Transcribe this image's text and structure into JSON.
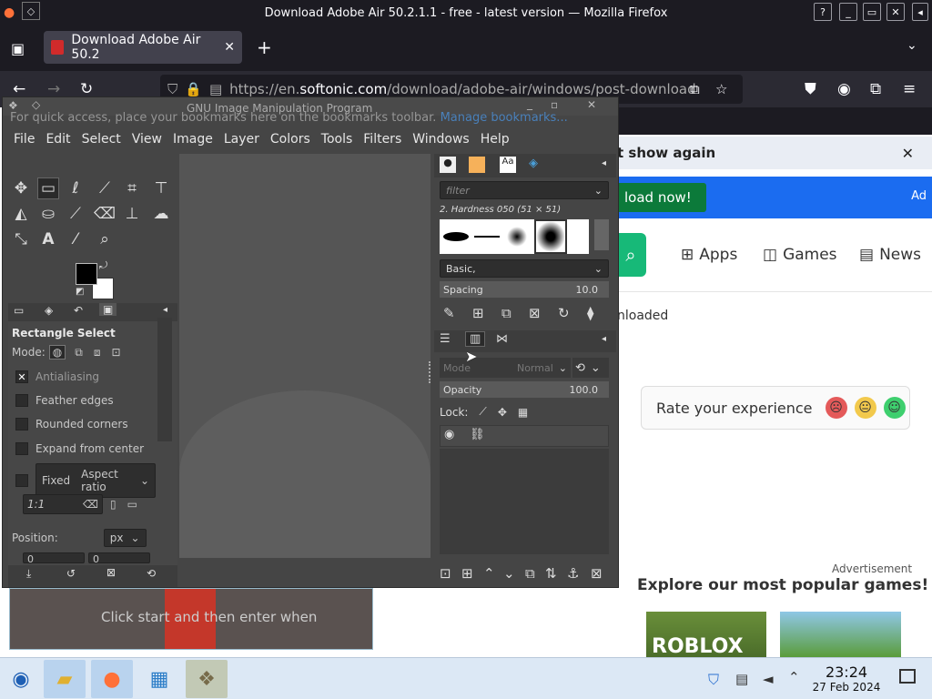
{
  "firefox": {
    "window_title": "Download Adobe Air 50.2.1.1 - free - latest version — Mozilla Firefox",
    "tab_title": "Download Adobe Air 50.2",
    "url_prefix": "https://en.",
    "url_domain": "softonic.com",
    "url_rest": "/download/adobe-air/windows/post-download",
    "bookmarks_hint": "For quick access, place your bookmarks here on the bookmarks toolbar.",
    "manage_bookmarks": "Manage bookmarks..."
  },
  "web": {
    "notice": "t show again",
    "download_now": "load now!",
    "ad_label": "Ad",
    "nav": [
      {
        "label": "Apps"
      },
      {
        "label": "Games"
      },
      {
        "label": "News"
      }
    ],
    "downloaded": "nloaded",
    "rate": "Rate your experience",
    "advertisement": "Advertisement",
    "explore": "Explore our most popular games!",
    "game1": "ROBLOX",
    "below_text": "Click start and then enter when"
  },
  "gimp": {
    "title": "GNU Image Manipulation Program",
    "menu": [
      {
        "label": "File"
      },
      {
        "label": "Edit"
      },
      {
        "label": "Select"
      },
      {
        "label": "View"
      },
      {
        "label": "Image"
      },
      {
        "label": "Layer"
      },
      {
        "label": "Colors"
      },
      {
        "label": "Tools"
      },
      {
        "label": "Filters"
      },
      {
        "label": "Windows"
      },
      {
        "label": "Help"
      }
    ],
    "tool_options_title": "Rectangle Select",
    "mode_label": "Mode:",
    "antialiasing": "Antialiasing",
    "feather": "Feather edges",
    "rounded": "Rounded corners",
    "expand": "Expand from center",
    "fixed": "Fixed",
    "aspect": "Aspect ratio",
    "ratio": "1:1",
    "position": "Position:",
    "unit": "px",
    "pos_x": "0",
    "pos_y": "0",
    "brush_filter": "filter",
    "brush_name": "2. Hardness 050 (51 × 51)",
    "brush_set": "Basic,",
    "spacing_label": "Spacing",
    "spacing_value": "10.0",
    "mode_small": "Mode",
    "mode_normal": "Normal",
    "opacity_label": "Opacity",
    "opacity_value": "100.0",
    "lock_label": "Lock:"
  },
  "taskbar": {
    "time": "23:24",
    "date": "27 Feb 2024"
  },
  "colors": {
    "gimp_bg": "#454545",
    "accent_green": "#17b978",
    "ff_dark": "#1c1b22",
    "taskbar": "#dce8f5"
  }
}
